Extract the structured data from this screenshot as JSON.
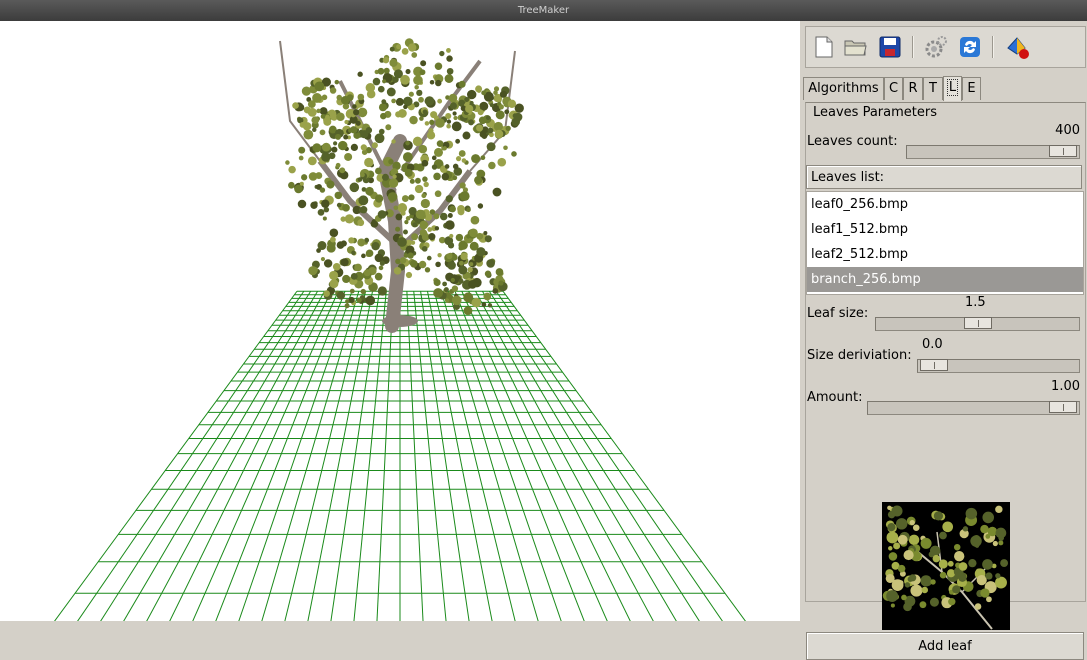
{
  "window": {
    "title": "TreeMaker"
  },
  "toolbar": {
    "buttons": [
      {
        "name": "new",
        "icon": "new-document-icon"
      },
      {
        "name": "open",
        "icon": "open-folder-icon"
      },
      {
        "name": "save",
        "icon": "save-icon"
      },
      {
        "name": "settings",
        "icon": "gear-icon"
      },
      {
        "name": "refresh",
        "icon": "refresh-icon"
      },
      {
        "name": "render",
        "icon": "render-icon"
      }
    ]
  },
  "tabs": [
    {
      "label": "Algorithms",
      "active": false
    },
    {
      "label": "C",
      "active": false
    },
    {
      "label": "R",
      "active": false
    },
    {
      "label": "T",
      "active": false
    },
    {
      "label": "L",
      "active": true
    },
    {
      "label": "E",
      "active": false
    }
  ],
  "leaves": {
    "group_title": "Leaves Parameters",
    "count_label": "Leaves count:",
    "count_value": "400",
    "count_fraction": 1.0,
    "list_header": "Leaves list:",
    "list": [
      "leaf0_256.bmp",
      "leaf1_512.bmp",
      "leaf2_512.bmp",
      "branch_256.bmp"
    ],
    "selected_index": 3,
    "leaf_size_label": "Leaf size:",
    "leaf_size_value": "1.5",
    "leaf_size_fraction": 0.5,
    "size_dev_label": "Size deriviation:",
    "size_dev_value": "0.0",
    "size_dev_fraction": 0.0,
    "amount_label": "Amount:",
    "amount_value": "1.00",
    "amount_fraction": 1.0,
    "add_button": "Add leaf"
  },
  "viewport": {
    "grid_color": "#1a8a1a",
    "background": "#ffffff",
    "foliage_color": "#6b7a2e"
  }
}
